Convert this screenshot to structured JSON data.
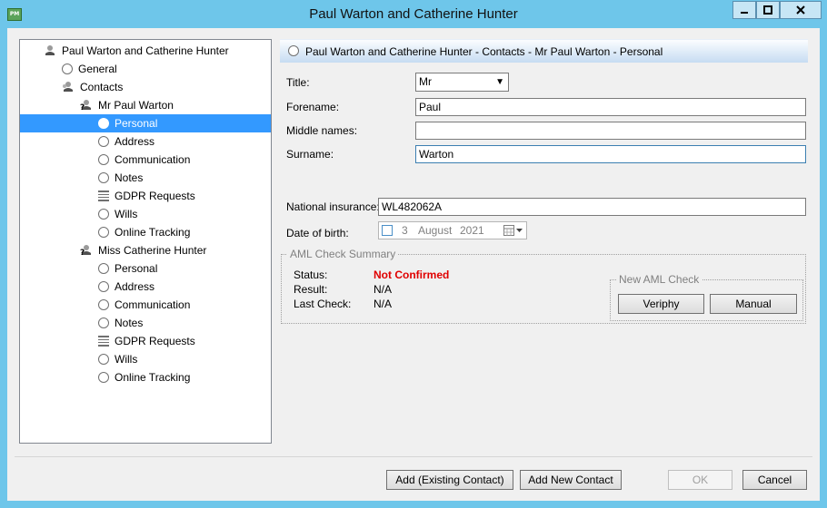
{
  "window": {
    "title": "Paul Warton and Catherine Hunter",
    "app_icon_text": "PM"
  },
  "tree": {
    "items": [
      {
        "label": "Paul Warton and Catherine Hunter",
        "icon": "person-icon",
        "level": 0,
        "selected": false
      },
      {
        "label": "General",
        "icon": "radio-icon",
        "level": 1,
        "selected": false
      },
      {
        "label": "Contacts",
        "icon": "people-icon",
        "level": 1,
        "selected": false
      },
      {
        "label": "Mr Paul Warton",
        "icon": "person-question-icon",
        "level": 2,
        "selected": false
      },
      {
        "label": "Personal",
        "icon": "radio-icon",
        "level": 3,
        "selected": true
      },
      {
        "label": "Address",
        "icon": "radio-icon",
        "level": 3,
        "selected": false
      },
      {
        "label": "Communication",
        "icon": "radio-icon",
        "level": 3,
        "selected": false
      },
      {
        "label": "Notes",
        "icon": "radio-icon",
        "level": 3,
        "selected": false
      },
      {
        "label": "GDPR Requests",
        "icon": "stack-icon",
        "level": 3,
        "selected": false
      },
      {
        "label": "Wills",
        "icon": "radio-icon",
        "level": 3,
        "selected": false
      },
      {
        "label": "Online Tracking",
        "icon": "radio-icon",
        "level": 3,
        "selected": false
      },
      {
        "label": "Miss Catherine Hunter",
        "icon": "person-question-icon",
        "level": 2,
        "selected": false
      },
      {
        "label": "Personal",
        "icon": "radio-icon",
        "level": 3,
        "selected": false
      },
      {
        "label": "Address",
        "icon": "radio-icon",
        "level": 3,
        "selected": false
      },
      {
        "label": "Communication",
        "icon": "radio-icon",
        "level": 3,
        "selected": false
      },
      {
        "label": "Notes",
        "icon": "radio-icon",
        "level": 3,
        "selected": false
      },
      {
        "label": "GDPR Requests",
        "icon": "stack-icon",
        "level": 3,
        "selected": false
      },
      {
        "label": "Wills",
        "icon": "radio-icon",
        "level": 3,
        "selected": false
      },
      {
        "label": "Online Tracking",
        "icon": "radio-icon",
        "level": 3,
        "selected": false
      }
    ]
  },
  "header": {
    "breadcrumb": "Paul Warton and Catherine Hunter - Contacts - Mr Paul Warton - Personal"
  },
  "form": {
    "title_label": "Title:",
    "title_value": "Mr",
    "forename_label": "Forename:",
    "forename_value": "Paul",
    "middle_label": "Middle names:",
    "middle_value": "",
    "surname_label": "Surname:",
    "surname_value": "Warton",
    "ni_label": "National insurance:",
    "ni_value": "WL482062A",
    "dob_label": "Date of birth:",
    "dob_day": "3",
    "dob_month": "August",
    "dob_year": "2021"
  },
  "aml": {
    "group_title": "AML Check Summary",
    "status_label": "Status:",
    "status_value": "Not Confirmed",
    "result_label": "Result:",
    "result_value": "N/A",
    "last_check_label": "Last Check:",
    "last_check_value": "N/A",
    "new_check_title": "New AML Check",
    "veriphy_label": "Veriphy",
    "manual_label": "Manual"
  },
  "footer": {
    "add_existing_label": "Add (Existing Contact)",
    "add_new_label": "Add New Contact",
    "ok_label": "OK",
    "cancel_label": "Cancel"
  },
  "colors": {
    "titlebar": "#6ec6ea",
    "selection": "#3399ff",
    "status_red": "#e00000"
  }
}
